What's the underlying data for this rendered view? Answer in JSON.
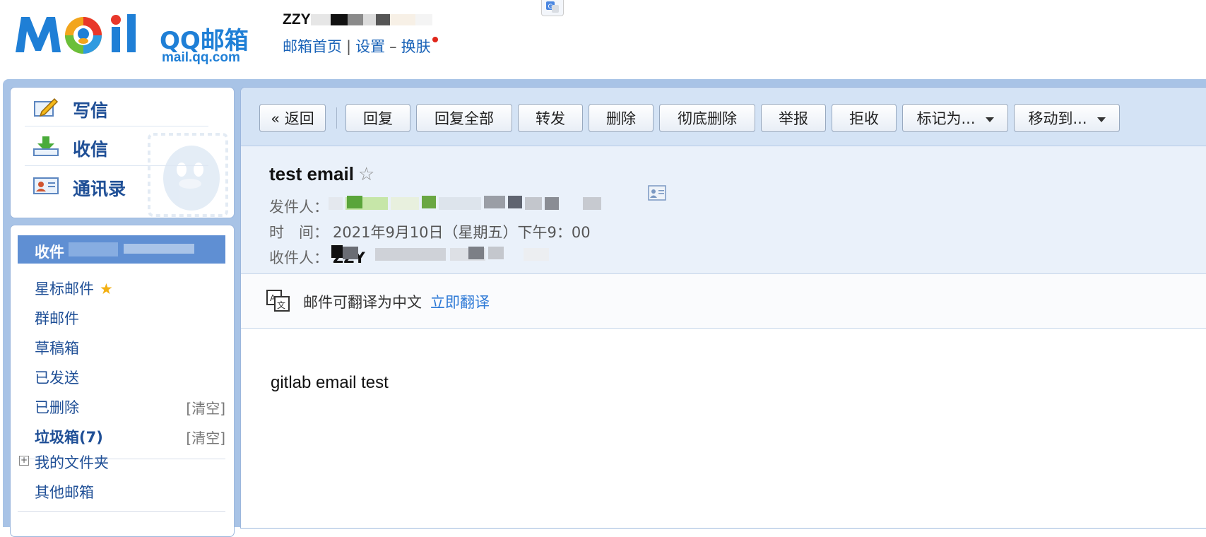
{
  "header": {
    "logo_text": "QQ邮箱",
    "logo_url": "mail.qq.com",
    "account_prefix": "ZZY",
    "links": {
      "home": "邮箱首页",
      "settings": "设置",
      "skin": "换肤"
    },
    "sep_pipe": "|",
    "sep_dash": "–"
  },
  "sidebar": {
    "actions": {
      "compose": "写信",
      "receive": "收信",
      "contacts": "通讯录"
    },
    "inbox_label": "收件",
    "folders": {
      "starred": "星标邮件",
      "group": "群邮件",
      "drafts": "草稿箱",
      "sent": "已发送",
      "deleted": "已删除",
      "spam": "垃圾箱(7)",
      "my_folders": "我的文件夹",
      "other": "其他邮箱"
    },
    "clear_label": "[清空]"
  },
  "toolbar": {
    "back": "« 返回",
    "reply": "回复",
    "reply_all": "回复全部",
    "forward": "转发",
    "delete": "删除",
    "delete_permanent": "彻底删除",
    "report": "举报",
    "reject": "拒收",
    "mark_as": "标记为...",
    "move_to": "移动到..."
  },
  "mail": {
    "subject": "test email",
    "star_glyph": "☆",
    "from_label": "发件人：",
    "time_label": "时　间：",
    "time_value": "2021年9月10日（星期五）下午9：00",
    "to_label": "收件人：",
    "to_prefix": "ZZY",
    "translate_text": "邮件可翻译为中文",
    "translate_link": "立即翻译",
    "body": "gitlab email test"
  },
  "colors": {
    "brand_blue": "#1f7fd6",
    "link_blue": "#1a63b8",
    "selected_bg": "#5f8fd3",
    "toolbar_bg": "#d4e3f5"
  }
}
